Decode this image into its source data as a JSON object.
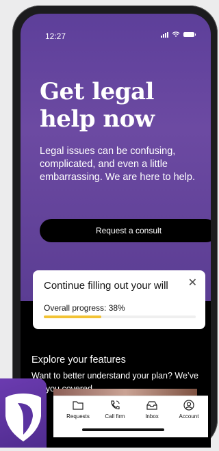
{
  "status_bar": {
    "time": "12:27"
  },
  "hero": {
    "title_line1": "Get legal",
    "title_line2": "help now",
    "subtitle": "Legal issues can be confusing, complicated, and even a little embarrassing. We are here to help.",
    "button_label": "Request a consult"
  },
  "will_card": {
    "title": "Continue filling out your will",
    "close_symbol": "✕",
    "progress_label": "Overall progress: 38%",
    "progress_value": 0.38
  },
  "explore": {
    "title": "Explore your features",
    "subtitle": "Want to better understand your plan? We’ve got you covered."
  },
  "nav": {
    "items": [
      {
        "label": "Requests",
        "icon": "folder-icon"
      },
      {
        "label": "Call firm",
        "icon": "phone-icon"
      },
      {
        "label": "Inbox",
        "icon": "inbox-icon"
      },
      {
        "label": "Account",
        "icon": "user-icon"
      }
    ]
  },
  "colors": {
    "hero_top": "#5d3f9a",
    "progress": "#f2c335",
    "logo": "#6b3bb0"
  }
}
